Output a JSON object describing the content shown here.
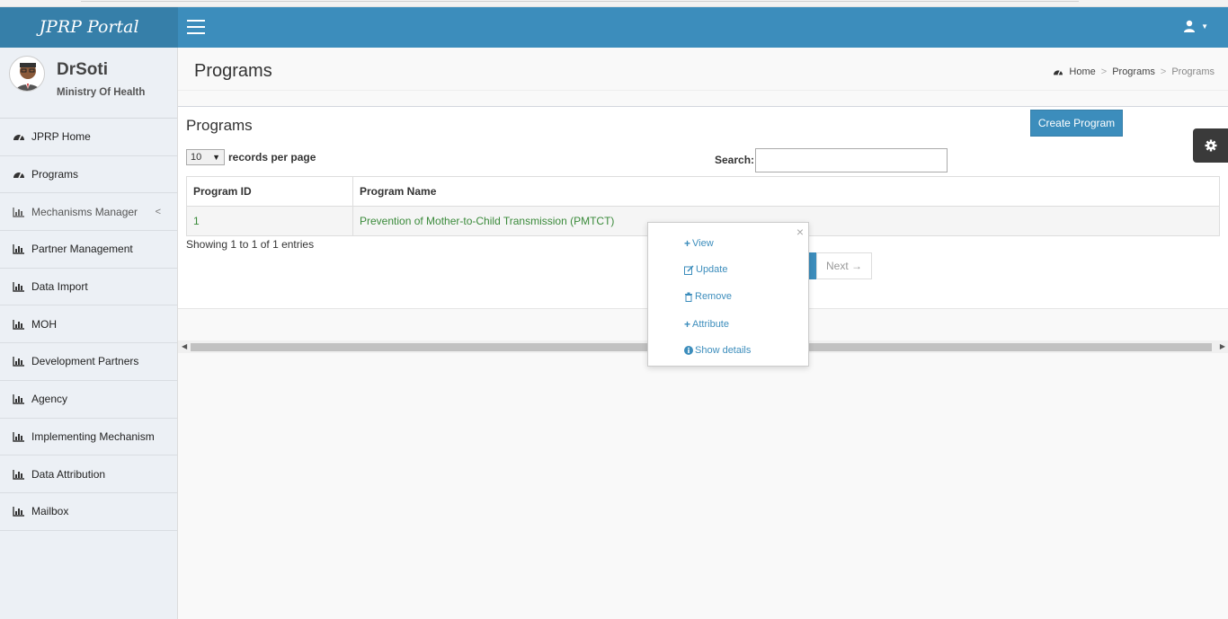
{
  "app": {
    "logo_text": "JPRP Portal"
  },
  "user": {
    "name": "DrSoti",
    "org": "Ministry Of Health"
  },
  "sidebar": {
    "items": [
      {
        "label": "JPRP Home",
        "icon": "dashboard-icon"
      },
      {
        "label": "Programs",
        "icon": "dashboard-icon"
      },
      {
        "label": "Mechanisms Manager",
        "icon": "bar-chart-icon",
        "has_children": true
      },
      {
        "label": "Partner Management",
        "icon": "bar-chart-icon"
      },
      {
        "label": "Data Import",
        "icon": "bar-chart-icon"
      },
      {
        "label": "MOH",
        "icon": "bar-chart-icon"
      },
      {
        "label": "Development Partners",
        "icon": "bar-chart-icon"
      },
      {
        "label": "Agency",
        "icon": "bar-chart-icon"
      },
      {
        "label": "Implementing Mechanism",
        "icon": "bar-chart-icon"
      },
      {
        "label": "Data Attribution",
        "icon": "bar-chart-icon"
      },
      {
        "label": "Mailbox",
        "icon": "bar-chart-icon"
      }
    ]
  },
  "header": {
    "page_title": "Programs",
    "breadcrumb": {
      "home": "Home",
      "level1": "Programs",
      "level2": "Programs"
    }
  },
  "box": {
    "title": "Programs",
    "create_button": "Create Program",
    "records_per_page_value": "10",
    "records_per_page_label": "records per page",
    "search_label": "Search:",
    "search_value": "",
    "columns": [
      "Program ID",
      "Program Name"
    ],
    "rows": [
      {
        "id": "1",
        "name": "Prevention of Mother-to-Child Transmission (PMTCT)"
      }
    ],
    "showing": "Showing 1 to 1 of 1 entries",
    "next_label": "Next →"
  },
  "popover": {
    "close": "×",
    "items": [
      {
        "label": "View",
        "icon": "plus-icon"
      },
      {
        "label": "Update",
        "icon": "edit-icon"
      },
      {
        "label": "Remove",
        "icon": "trash-icon"
      },
      {
        "label": "Attribute",
        "icon": "plus-icon"
      },
      {
        "label": "Show details",
        "icon": "info-icon"
      }
    ]
  },
  "colors": {
    "header": "#3c8dbc",
    "logo_bg": "#367fa9",
    "link": "#3c8dbc",
    "row_text": "#3a8a3a"
  }
}
